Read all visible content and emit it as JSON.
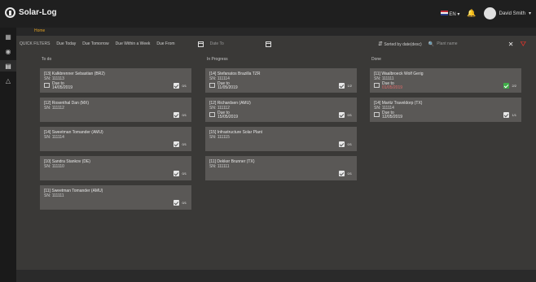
{
  "app": {
    "title": "Solar-Log"
  },
  "breadcrumb": "Home",
  "header": {
    "language": "EN",
    "user_name": "David Smith"
  },
  "sidebar": {
    "items": [
      {
        "icon": "dashboard-icon"
      },
      {
        "icon": "globe-icon"
      },
      {
        "icon": "tasks-icon"
      },
      {
        "icon": "alerts-icon"
      }
    ]
  },
  "filters": {
    "label": "QUICK FILTERS",
    "buttons": [
      "Due Today",
      "Due Tomorrow",
      "Due Within a Week"
    ],
    "due_from_label": "Due From",
    "due_to_placeholder": "Date To",
    "sort_label": "Sorted by date(desc)",
    "search_placeholder": "Plant name"
  },
  "columns": [
    {
      "title": "To do",
      "cards": [
        {
          "title": "[13] Kalkbrenner Sebastian (BR2)",
          "sn": "SN: 111113",
          "due_label": "Due to",
          "due_date": "14/05/2019",
          "overdue": false,
          "progress": "0/1",
          "done": false
        },
        {
          "title": "[12] Rosenthal Dan (MX)",
          "sn": "SN: 111112",
          "due_label": "",
          "due_date": "",
          "overdue": false,
          "progress": "0/1",
          "done": false
        },
        {
          "title": "[14] Sweetman Tomander (AMU)",
          "sn": "SN: 111114",
          "due_label": "",
          "due_date": "",
          "overdue": false,
          "progress": "0/1",
          "done": false
        },
        {
          "title": "[10] Sandra Stankov (DE)",
          "sn": "SN: 111110",
          "due_label": "",
          "due_date": "",
          "overdue": false,
          "progress": "0/1",
          "done": false
        },
        {
          "title": "[11] Sweetman Tomander (AMU)",
          "sn": "SN: 111111",
          "due_label": "",
          "due_date": "",
          "overdue": false,
          "progress": "0/1",
          "done": false
        }
      ]
    },
    {
      "title": "In Progress",
      "cards": [
        {
          "title": "[14] Stefanatos Brazilla TZR",
          "sn": "SN: 111114",
          "due_label": "Due to",
          "due_date": "11/05/2019",
          "overdue": false,
          "progress": "1/2",
          "done": false
        },
        {
          "title": "[12] Richardsen (AMU)",
          "sn": "SN: 111112",
          "due_label": "Due to",
          "due_date": "15/05/2019",
          "overdue": false,
          "progress": "0/1",
          "done": false
        },
        {
          "title": "[15] Infrastructure Solar Plant",
          "sn": "SN: 111115",
          "due_label": "",
          "due_date": "",
          "overdue": false,
          "progress": "0/1",
          "done": false
        },
        {
          "title": "[11] Dekker Brunner (TX)",
          "sn": "SN: 111111",
          "due_label": "",
          "due_date": "",
          "overdue": false,
          "progress": "0/1",
          "done": false
        }
      ]
    },
    {
      "title": "Done",
      "cards": [
        {
          "title": "[11] Waalbroeck Wolf Gerig",
          "sn": "SN: 111111",
          "due_label": "Due to",
          "due_date": "01/05/2019",
          "overdue": true,
          "progress": "2/2",
          "done": true
        },
        {
          "title": "[14] Maritz Traveldorp (TX)",
          "sn": "SN: 111114",
          "due_label": "Due to",
          "due_date": "12/05/2019",
          "overdue": false,
          "progress": "1/1",
          "done": false
        }
      ]
    }
  ],
  "colors": {
    "accent": "#e0a022",
    "done_check": "#3fae48",
    "overdue": "#e06a6a",
    "clear_filter": "#d9342b"
  }
}
